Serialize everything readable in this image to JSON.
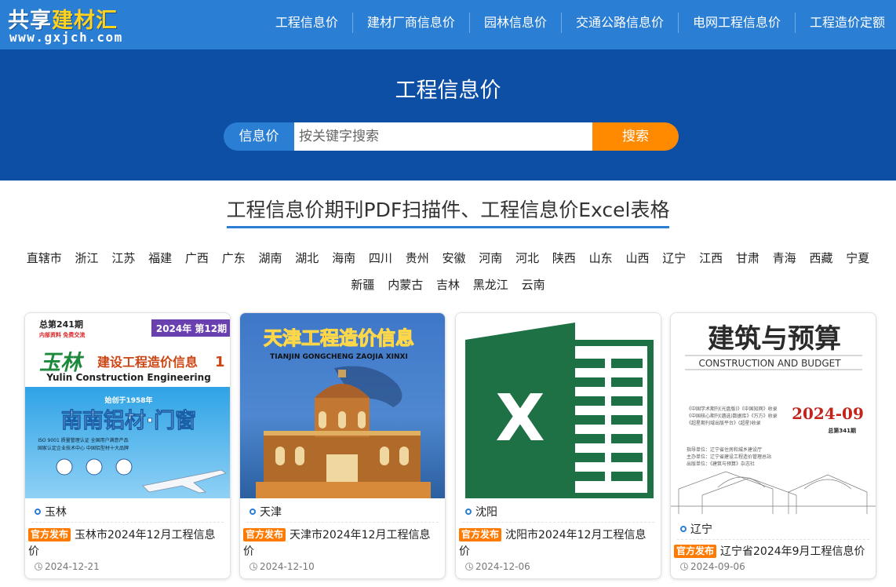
{
  "logo": {
    "part1": "共享",
    "part2": "建材汇",
    "url": "www.gxjch.com"
  },
  "nav": [
    "工程信息价",
    "建材厂商信息价",
    "园林信息价",
    "交通公路信息价",
    "电网工程信息价",
    "工程造价定额"
  ],
  "hero": {
    "title": "工程信息价",
    "search_label": "信息价",
    "search_placeholder": "按关键字搜索",
    "search_button": "搜索"
  },
  "section_title": "工程信息价期刊PDF扫描件、工程信息价Excel表格",
  "regions": [
    "直辖市",
    "浙江",
    "江苏",
    "福建",
    "广西",
    "广东",
    "湖南",
    "湖北",
    "海南",
    "四川",
    "贵州",
    "安徽",
    "河南",
    "河北",
    "陕西",
    "山东",
    "山西",
    "辽宁",
    "江西",
    "甘肃",
    "青海",
    "西藏",
    "宁夏",
    "新疆",
    "内蒙古",
    "吉林",
    "黑龙江",
    "云南"
  ],
  "cards": [
    {
      "city": "玉林",
      "badge": "官方发布",
      "title": "玉林市2024年12月工程信息价",
      "date": "2024-12-21",
      "cover": {
        "issue_total": "总第241期",
        "issue_note": "内部资料 免费交流",
        "year_issue": "2024年 第12期",
        "name_logo": "玉林",
        "name_rest": "建设工程造价信息",
        "name_num": "1",
        "english": "Yulin Construction Engineering",
        "ad_since": "始创于1958年",
        "ad_brand": "南南铝材·门窗",
        "ad_line1": "ISO 9001 质量管理认证  全国用户满意产品",
        "ad_line2": "国家认定企业技术中心  中国铝型材十大品牌"
      }
    },
    {
      "city": "天津",
      "badge": "官方发布",
      "title": "天津市2024年12月工程信息价",
      "date": "2024-12-10",
      "cover": {
        "title": "天津工程造价信息",
        "pinyin": "TIANJIN GONGCHENG ZAOJIA XINXI"
      }
    },
    {
      "city": "沈阳",
      "badge": "官方发布",
      "title": "沈阳市2024年12月工程信息价",
      "date": "2024-12-06",
      "cover": {
        "letter": "X"
      }
    },
    {
      "city": "辽宁",
      "badge": "官方发布",
      "title": "辽宁省2024年9月工程信息价",
      "date": "2024-09-06",
      "cover": {
        "title": "建筑与预算",
        "english": "CONSTRUCTION AND BUDGET",
        "issue": "2024-09",
        "issue_total": "总第341期",
        "index1": "《中国学术期刊(光盘版)》《中国知网》收录",
        "index2": "《中国核心期刊(遴选)数据库》《万方》收录",
        "index3": "《超星期刊域出版平台》(超星)收录",
        "host": "指导单位：辽宁省住房和城乡建设厅",
        "sponsor": "主办单位：辽宁省建设工程造价管理总站",
        "publisher": "出版单位：《建筑与预算》杂志社"
      }
    }
  ]
}
